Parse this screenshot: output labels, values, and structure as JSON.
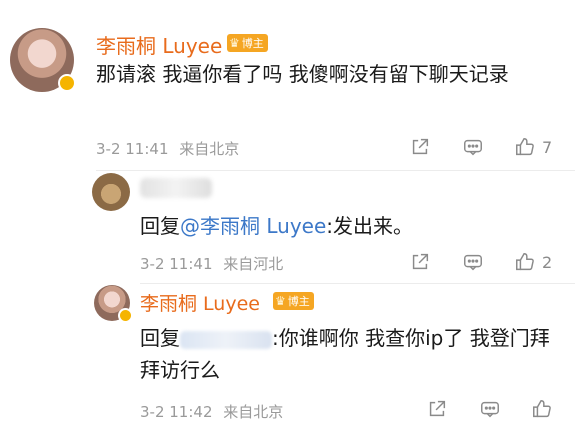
{
  "comments": [
    {
      "username": "李雨桐 Luyee",
      "badge": "博主",
      "text": "那请滚 我逼你看了吗 我傻啊没有留下聊天记录",
      "date": "3-2 11:41",
      "location": "来自北京",
      "likes": "7"
    },
    {
      "reply_prefix": "回复",
      "mention": "@李雨桐 Luyee",
      "text": ":发出来。",
      "date": "3-2 11:41",
      "location": "来自河北",
      "likes": "2"
    },
    {
      "username": "李雨桐 Luyee",
      "badge": "博主",
      "reply_prefix": "回复",
      "text": ":你谁啊你 我查你ip了 我登门拜拜访行么",
      "date": "3-2 11:42",
      "location": "来自北京"
    }
  ],
  "icons": [
    "share-icon",
    "comment-icon",
    "like-icon"
  ]
}
